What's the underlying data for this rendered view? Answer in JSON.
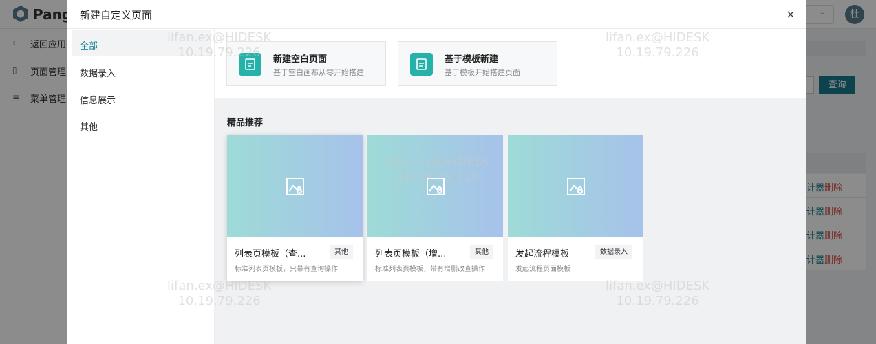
{
  "app": {
    "brand": "Pange",
    "avatar": "杜"
  },
  "bg_sidebar": [
    {
      "icon": "‹",
      "label": "返回应用"
    },
    {
      "icon": "▯",
      "label": "页面管理"
    },
    {
      "icon": "≡",
      "label": "菜单管理"
    }
  ],
  "bg_toolbar": {
    "query_label": "查询"
  },
  "bg_rows": [
    {
      "design": "计器",
      "delete": "删除"
    },
    {
      "design": "计器",
      "delete": "删除"
    },
    {
      "design": "计器",
      "delete": "删除"
    },
    {
      "design": "计器",
      "delete": "删除"
    }
  ],
  "modal": {
    "title": "新建自定义页面",
    "close": "×",
    "categories": [
      "全部",
      "数据录入",
      "信息展示",
      "其他"
    ],
    "create_options": [
      {
        "title": "新建空白页面",
        "desc": "基于空白画布从零开始搭建"
      },
      {
        "title": "基于模板新建",
        "desc": "基于模板开始搭建页面"
      }
    ],
    "section_title": "精品推荐",
    "templates": [
      {
        "name": "列表页模板（查...",
        "tag": "其他",
        "desc": "标准列表页模板，只带有查询操作"
      },
      {
        "name": "列表页模板（增...",
        "tag": "其他",
        "desc": "标准列表页模板，带有增删改查操作"
      },
      {
        "name": "发起流程模板",
        "tag": "数据录入",
        "desc": "发起流程页面模板"
      }
    ]
  },
  "watermark": {
    "line1": "lifan.ex@HIDESK",
    "line2": "10.19.79.226"
  },
  "colors": {
    "accent": "#1d8a9a",
    "icon_bg": "#26b1a9",
    "danger": "#d9534f"
  }
}
